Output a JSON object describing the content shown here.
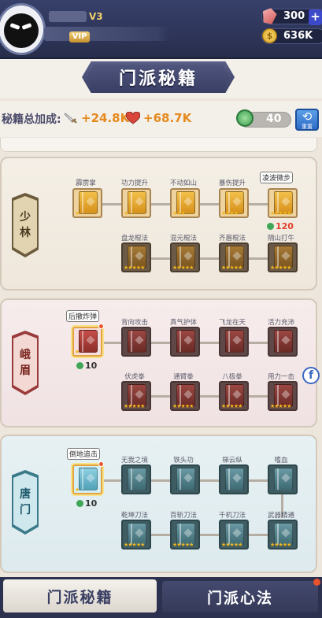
{
  "player": {
    "level": "V3",
    "vip": "VIP"
  },
  "resources": {
    "gems": "300",
    "gold": "636K",
    "plus": "+",
    "coin_glyph": "$"
  },
  "title": "门派秘籍",
  "bonus": {
    "label": "秘籍总加成:",
    "attack": "+24.8K",
    "hp": "+68.7K"
  },
  "points": {
    "value": "40",
    "reset_label": "重置"
  },
  "sects": [
    {
      "name_top": "少",
      "name_bottom": "林"
    },
    {
      "name_top": "峨",
      "name_bottom": "眉"
    },
    {
      "name_top": "唐",
      "name_bottom": "门"
    }
  ],
  "shaolin": {
    "row1": [
      "霹雳掌",
      "功力提升",
      "不动如山",
      "暴伤提升",
      "凌波微步"
    ],
    "row2": [
      "盘龙棍法",
      "混元棍法",
      "齐眉棍法",
      "隔山打牛"
    ],
    "bubble": "凌波微步",
    "cost": "120"
  },
  "emei": {
    "row1": [
      "后撤炸弹",
      "背向攻击",
      "真气护体",
      "飞龙在天",
      "活力充沛"
    ],
    "row2": [
      "伏虎拳",
      "通臂拳",
      "八极拳",
      "用力一击"
    ],
    "bubble": "后撤炸弹",
    "cost": "10"
  },
  "tangmen": {
    "row1": [
      "倒地追击",
      "无我之境",
      "铁头功",
      "梯云纵",
      "嗜血"
    ],
    "row2": [
      "乾坤刀法",
      "百斩刀法",
      "千机刀法",
      "武器精通"
    ],
    "bubble": "倒地追击",
    "cost": "10"
  },
  "side": {
    "facebook": "f"
  },
  "tabs": {
    "secrets": "门派秘籍",
    "heart": "门派心法"
  }
}
